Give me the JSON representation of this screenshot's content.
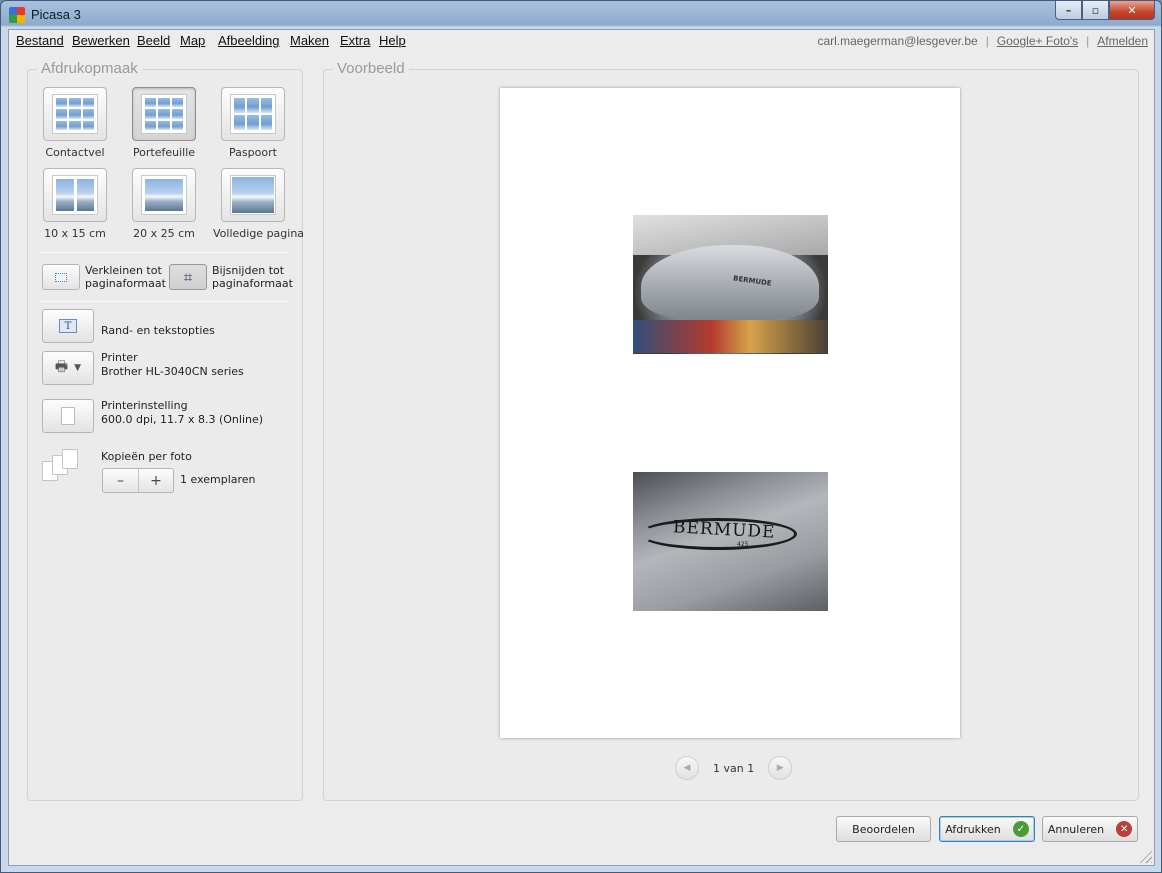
{
  "window": {
    "title": "Picasa 3",
    "min_label": "–",
    "max_label": "▫",
    "close_label": "✕"
  },
  "menu": {
    "items": [
      "Bestand",
      "Bewerken",
      "Beeld",
      "Map",
      "Afbeelding",
      "Maken",
      "Extra",
      "Help"
    ],
    "account_email": "carl.maegerman@lesgever.be",
    "separator": "|",
    "google_link": "Google+ Foto's",
    "logout_link": "Afmelden"
  },
  "layout_panel": {
    "title": "Afdrukopmaak",
    "options": [
      {
        "label": "Contactvel",
        "selected": false
      },
      {
        "label": "Portefeuille",
        "selected": true
      },
      {
        "label": "Paspoort",
        "selected": false
      },
      {
        "label": "10 x 15 cm",
        "selected": false
      },
      {
        "label": "20 x 25 cm",
        "selected": false
      },
      {
        "label": "Volledige pagina",
        "selected": false
      }
    ],
    "fit_label_1": "Verkleinen tot",
    "fit_label_2": "paginaformaat",
    "crop_label_1": "Bijsnijden tot",
    "crop_label_2": "paginaformaat",
    "border_text_label": "Rand- en tekstopties",
    "printer_heading": "Printer",
    "printer_name": "Brother HL-3040CN series",
    "printer_settings_heading": "Printerinstelling",
    "printer_settings_value": "600.0 dpi, 11.7 x 8.3 (Online)",
    "copies_heading": "Kopieën per foto",
    "minus": "–",
    "plus": "+",
    "copies_value": "1 exemplaren"
  },
  "preview_panel": {
    "title": "Voorbeeld",
    "photo1_brand": "BERMUDE",
    "photo2_brand": "BERMUDE",
    "photo2_model": "425",
    "prev": "◀",
    "next": "▶",
    "page_indicator": "1 van 1"
  },
  "actions": {
    "review": "Beoordelen",
    "print": "Afdrukken",
    "cancel": "Annuleren",
    "ok_glyph": "✓",
    "cancel_glyph": "✕"
  }
}
